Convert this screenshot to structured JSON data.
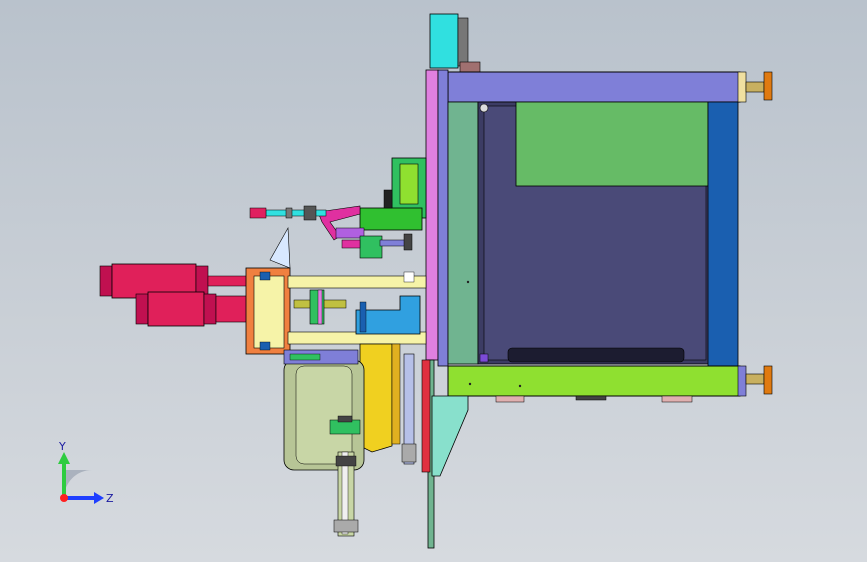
{
  "viewport": {
    "background_top": "#b9c2cc",
    "background_bottom": "#d6dadf"
  },
  "triad": {
    "y_label": "Y",
    "z_label": "Z",
    "y_color": "#2ecc40",
    "z_color": "#1f3fff",
    "x_color": "#ff2020"
  },
  "model": {
    "name_icon": "cad-assembly",
    "colors": {
      "frame_blue": "#7f7fd8",
      "plate_green": "#70b490",
      "cavity": "#3c3c64",
      "light_green": "#66bb66",
      "side_blue": "#1a5fb0",
      "base_green": "#8fe030",
      "cylinder_red": "#e0205a",
      "rod_yellow": "#f6f3a8",
      "cyan": "#30e0e0",
      "pink": "#e080e0",
      "gray_wheel": "#b7c596"
    }
  }
}
